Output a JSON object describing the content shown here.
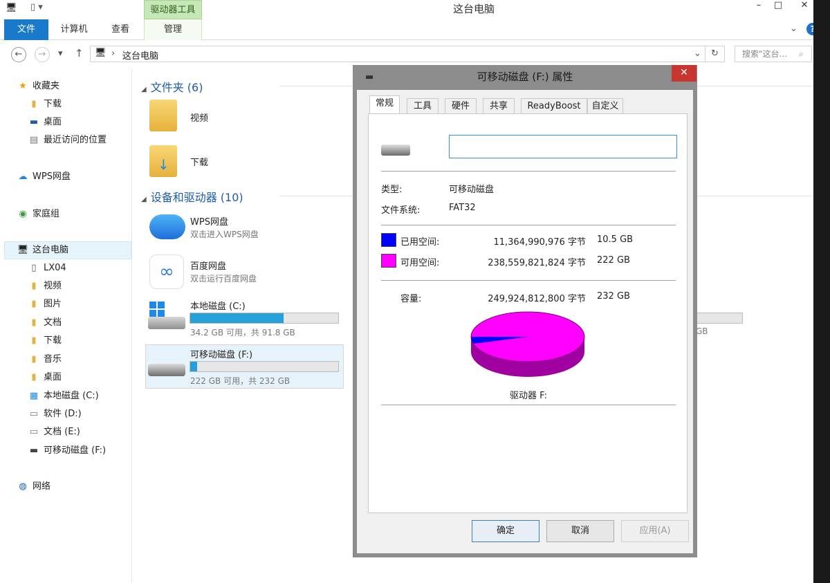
{
  "window": {
    "title": "这台电脑",
    "contextual_tab": "驱动器工具",
    "minimize": "–",
    "maximize": "□",
    "close": "✕"
  },
  "ribbon": {
    "tabs": [
      "文件",
      "计算机",
      "查看",
      "管理"
    ],
    "help": "?"
  },
  "address": {
    "path": "这台电脑",
    "search_placeholder": "搜索\"这台...",
    "back_icon": "←",
    "forward_icon": "→",
    "up_icon": "↑",
    "refresh_icon": "↻"
  },
  "nav": {
    "favorites": [
      {
        "label": "收藏夹",
        "icon": "star-icon"
      },
      {
        "label": "下载"
      },
      {
        "label": "桌面"
      },
      {
        "label": "最近访问的位置"
      }
    ],
    "wps": "WPS网盘",
    "homegroup": "家庭组",
    "thispc": "这台电脑",
    "pc_items": [
      "LX04",
      "视频",
      "图片",
      "文档",
      "下载",
      "音乐",
      "桌面",
      "本地磁盘 (C:)",
      "软件 (D:)",
      "文档 (E:)",
      "可移动磁盘 (F:)"
    ],
    "network": "网络"
  },
  "main": {
    "folders_header": "文件夹 (6)",
    "folders": [
      "视频",
      "下载"
    ],
    "devices_header": "设备和驱动器 (10)",
    "devices": [
      {
        "name": "WPS网盘",
        "sub": "双击进入WPS网盘"
      },
      {
        "name": "百度网盘",
        "sub": "双击运行百度网盘"
      },
      {
        "name": "本地磁盘 (C:)",
        "sub": "34.2 GB 可用，共 91.8 GB",
        "used_fraction": 0.63
      },
      {
        "name": "可移动磁盘 (F:)",
        "sub": "222 GB 可用，共 232 GB",
        "used_fraction": 0.045
      }
    ],
    "hidden_sub": "GB"
  },
  "dialog": {
    "title": "可移动磁盘 (F:) 属性",
    "tabs": [
      "常规",
      "工具",
      "硬件",
      "共享",
      "ReadyBoost",
      "自定义"
    ],
    "volume_name": "",
    "type_label": "类型:",
    "type_value": "可移动磁盘",
    "fs_label": "文件系统:",
    "fs_value": "FAT32",
    "used_label": "已用空间:",
    "used_bytes": "11,364,990,976 字节",
    "used_gb": "10.5 GB",
    "used_color": "#0000ff",
    "free_label": "可用空间:",
    "free_bytes": "238,559,821,824 字节",
    "free_gb": "222 GB",
    "free_color": "#ff00ff",
    "cap_label": "容量:",
    "cap_bytes": "249,924,812,800 字节",
    "cap_gb": "232 GB",
    "drive_label": "驱动器 F:",
    "buttons": {
      "ok": "确定",
      "cancel": "取消",
      "apply": "应用(A)"
    },
    "used_fraction": 0.0455
  }
}
